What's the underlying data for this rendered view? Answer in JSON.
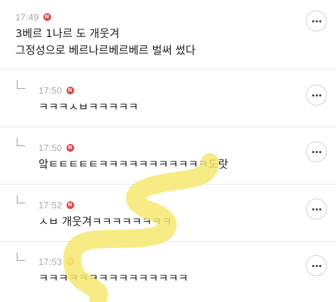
{
  "comments": [
    {
      "time": "17:49",
      "badge": "N",
      "lines": [
        "3베르 1나르 도 개웃겨",
        "그정성으로 베르나르베르베르 벌써 썼다"
      ]
    },
    {
      "time": "17:50",
      "badge": "N",
      "text": "ㅋㅋㅋㅅㅂㅋㅋㅋㅋㅋ"
    },
    {
      "time": "17:50",
      "badge": "N",
      "text": "앜ㅌㅌㅌㅌㅌㅋㅋㅋㅋㅋㅋㅋㅋㅋㅋㅋ도랏"
    },
    {
      "time": "17:52",
      "badge": "N",
      "text": "ㅅㅂ 개웃겨ㅋㅋㅋㅋㅋㅋㅋㅋ"
    },
    {
      "time": "17:53",
      "badge": "N",
      "text": "ㅋㅋㅋㅋㅋㅋㅋㅋㅋㅋㅋㅋㅋㅋㅋ"
    }
  ],
  "colors": {
    "badge": "#e04848",
    "highlighter": "#f5e66a",
    "timestamp": "#a8a8a8"
  },
  "icons": {
    "more": "more-options-icon",
    "reply": "reply-indent-icon",
    "badge": "new-badge-icon"
  }
}
